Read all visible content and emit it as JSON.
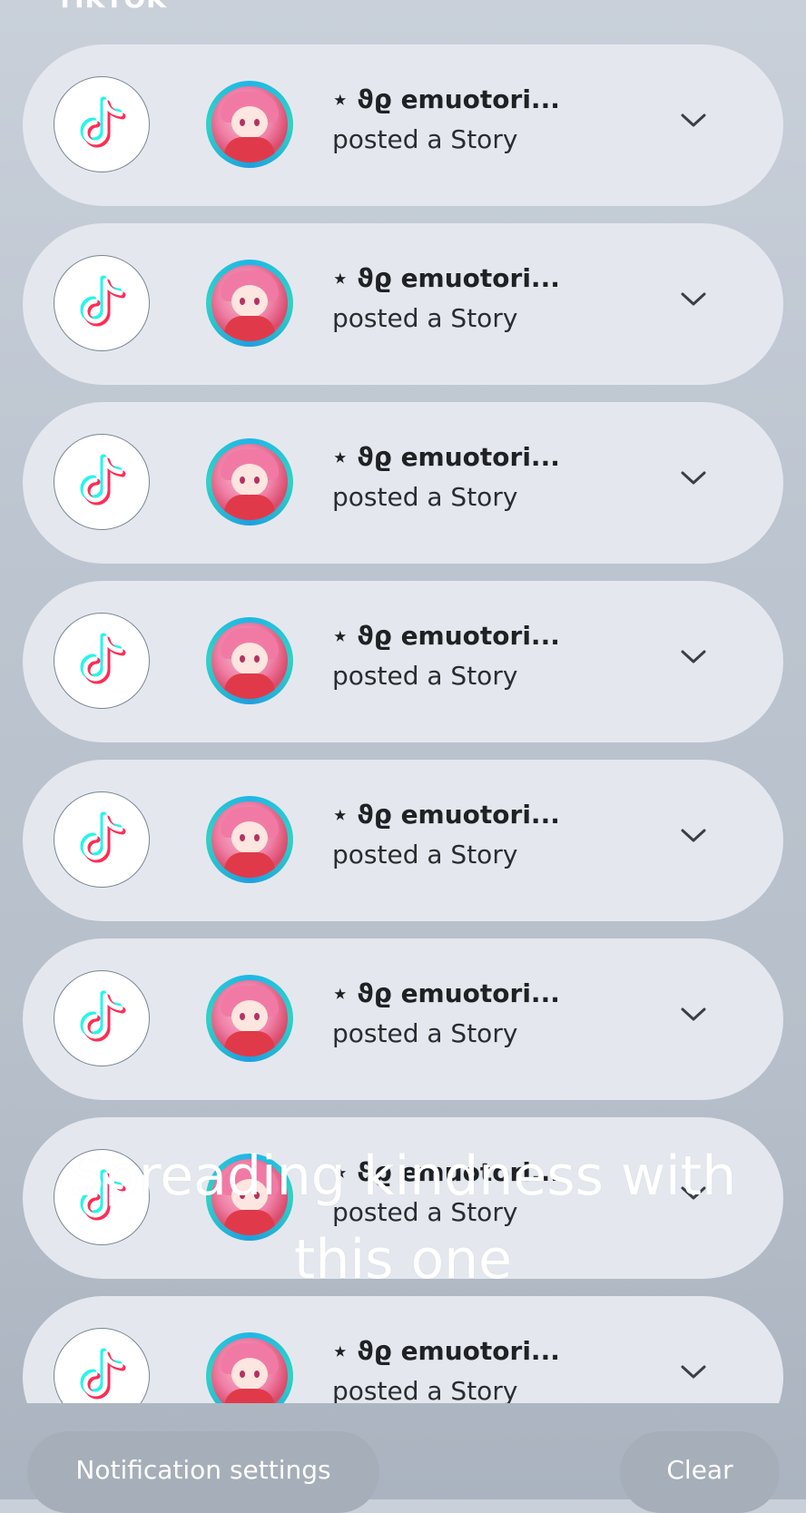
{
  "header": {
    "app_name": "TIKTOK"
  },
  "notifications": [
    {
      "title": "⋆ ϑϱ emuotori...",
      "text": "posted a Story"
    },
    {
      "title": "⋆ ϑϱ emuotori...",
      "text": "posted a Story"
    },
    {
      "title": "⋆ ϑϱ emuotori...",
      "text": "posted a Story"
    },
    {
      "title": "⋆ ϑϱ emuotori...",
      "text": "posted a Story"
    },
    {
      "title": "⋆ ϑϱ emuotori...",
      "text": "posted a Story"
    },
    {
      "title": "⋆ ϑϱ emuotori...",
      "text": "posted a Story"
    },
    {
      "title": "⋆ ϑϱ emuotori...",
      "text": "posted a Story"
    },
    {
      "title": "⋆ ϑϱ emuotori...",
      "text": "posted a Story"
    }
  ],
  "icons": {
    "app": "tiktok-logo-icon",
    "expand": "chevron-down-icon"
  },
  "overlay": {
    "line1": "Spreading kindness with",
    "line2": "this one"
  },
  "footer": {
    "settings_label": "Notification settings",
    "clear_label": "Clear"
  },
  "colors": {
    "card": "#e4e8ee",
    "button": "#a6aeb9",
    "avatar_ring": "#1fb6e8",
    "tiktok_cyan": "#25f4ee",
    "tiktok_red": "#fe2c55"
  }
}
